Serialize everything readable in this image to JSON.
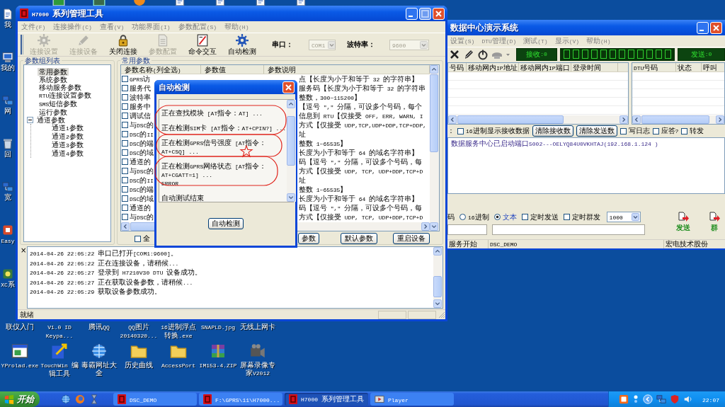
{
  "desktop": {
    "left_icons": [
      {
        "label": "我"
      },
      {
        "label": "我的"
      },
      {
        "label": "网"
      },
      {
        "label": "回"
      },
      {
        "label": "宽"
      },
      {
        "label": "Easy"
      },
      {
        "label": "XC系"
      }
    ],
    "row_1_icons": [
      {
        "label": "联仪入门"
      },
      {
        "label": "V1.0 ID Keypa..."
      },
      {
        "label": "腾讯QQ"
      },
      {
        "label": "QQ图片 20140320..."
      },
      {
        "label": "16进制浮点转换.exe"
      },
      {
        "label": "SNAPLD.jpg"
      },
      {
        "label": "无线上网卡"
      }
    ],
    "row_2_icons": [
      {
        "label": "YProlad.exe"
      },
      {
        "label": "TouchWin 编辑工具"
      },
      {
        "label": "毒霸网址大全"
      },
      {
        "label": "历史曲线"
      },
      {
        "label": "AccessPort"
      },
      {
        "label": "IM153-4.ZIP"
      },
      {
        "label": "屏幕录像专家V2012"
      }
    ]
  },
  "main_window": {
    "title": "H7000 系列管理工具",
    "menu": [
      "文件(F)",
      "连接操作(C)",
      "查看(V)",
      "功能界面(I)",
      "参数配置(S)",
      "帮助(H)"
    ],
    "toolbar": [
      {
        "label": "连接设置",
        "disabled": true
      },
      {
        "label": "连接设备",
        "disabled": true
      },
      {
        "label": "关闭连接",
        "disabled": false
      },
      {
        "label": "参数配置",
        "disabled": true
      },
      {
        "label": "命令交互",
        "disabled": false
      },
      {
        "label": "自动检测",
        "disabled": false
      }
    ],
    "port": {
      "label": "串口：",
      "value": "COM1",
      "disabled": true
    },
    "baud": {
      "label": "波特率：",
      "value": "9600",
      "disabled": true
    },
    "tree": {
      "title": "参数组列表",
      "items": [
        {
          "label": "常用参数",
          "selected": true
        },
        {
          "label": "系统参数",
          "selected": false
        },
        {
          "label": "移动服务参数",
          "selected": false
        },
        {
          "label": "RTU连接设置参数",
          "selected": false
        },
        {
          "label": "SMS短信参数",
          "selected": false
        },
        {
          "label": "运行参数",
          "selected": false
        },
        {
          "label": "通道参数",
          "selected": false,
          "expanded": true,
          "children": [
            {
              "label": "通道1参数",
              "selected": false
            },
            {
              "label": "通道2参数",
              "selected": false
            },
            {
              "label": "通道3参数",
              "selected": false
            },
            {
              "label": "通道4参数",
              "selected": false
            }
          ]
        }
      ]
    },
    "params": {
      "title": "常用参数",
      "columns": [
        "参数名称(列全选)",
        "参数值",
        "参数说明"
      ],
      "rows": [
        {
          "checked": false,
          "name": "GPRS访",
          "description": "点【长度为小于和等于 32 的字符串】"
        },
        {
          "checked": false,
          "name": "服务代",
          "description": "服务码【长度为小于和等于 32 的字符串"
        },
        {
          "checked": false,
          "name": "波特率",
          "description": "整数，300~115200】"
        },
        {
          "checked": false,
          "name": "服务中",
          "description": "【逗号 \",\" 分隔，可设多个号码，每个"
        },
        {
          "checked": false,
          "name": "调试信",
          "description": "信息到 RTU【仅接受 OFF, ERR, WARN, I"
        },
        {
          "checked": false,
          "name": "与DSC的",
          "description": "方式【仅接受 UDP,TCP,UDP+DDP,TCP+DDP,"
        },
        {
          "checked": false,
          "name": "DSC的II",
          "description": "址"
        },
        {
          "checked": false,
          "name": "DSC的端",
          "description": "整数 1~65535】"
        },
        {
          "checked": false,
          "name": "DSC的域",
          "description": "长度为小于和等于 64 的域名字符串】"
        },
        {
          "checked": false,
          "name": "通道的",
          "description": "码【逗号 \",\" 分隔，可设多个号码，每"
        },
        {
          "checked": false,
          "name": "与DSC的",
          "description": "方式【仅接受 UDP, TCP, UDP+DDP,TCP+D"
        },
        {
          "checked": false,
          "name": "DSC的II",
          "description": "址"
        },
        {
          "checked": false,
          "name": "DSC的端",
          "description": "整数 1~65535】"
        },
        {
          "checked": false,
          "name": "DSC的域",
          "description": "长度为小于和等于 64 的域名字符串】"
        },
        {
          "checked": false,
          "name": "通道的",
          "description": "码【逗号 \",\" 分隔，可设多个号码，每"
        },
        {
          "checked": false,
          "name": "与DSC的",
          "description": "方式【仅接受 UDP, TCP, UDP+DDP,TCP+D"
        }
      ],
      "select_all": {
        "label": "全",
        "checked": false
      },
      "buttons": [
        "参数",
        "默认参数",
        "重启设备"
      ]
    },
    "log_close": "×",
    "log": [
      "2014-04-26 22:05:22 串口已打开[COM1:9600]。",
      "2014-04-26 22:05:22 正在连接设备，请稍候...",
      "2014-04-26 22:05:27 登录到 H7210V30 DTU 设备成功。",
      "2014-04-26 22:05:27 正在获取设备参数，请稍候...",
      "2014-04-26 22:05:29 获取设备参数成功。"
    ],
    "status": "就绪"
  },
  "dialog": {
    "title": "自动检测",
    "lines": [
      {
        "kind": "step",
        "text": "正在查找模块 [AT指令：AT] ..."
      },
      {
        "kind": "step",
        "text": "正在检测SIM卡 [AT指令：AT+CPIN?] ..."
      },
      {
        "kind": "step",
        "text": "正在检测GPRS信号强度 [AT指令："
      },
      {
        "kind": "more",
        "text": "AT+CSQ] ..."
      },
      {
        "kind": "step",
        "text": "正在检测GPRS网络状态 [AT指令："
      },
      {
        "kind": "more",
        "text": "AT+CGATT=1] ..."
      },
      {
        "kind": "more",
        "text": "ERROR"
      },
      {
        "kind": "step",
        "text": "自动测试结束"
      }
    ],
    "button": "自动检测"
  },
  "back_window": {
    "title": "数据中心演示系统",
    "menu": [
      "设置(S)",
      "DTU管理(D)",
      "测试(T)",
      "显示(V)",
      "帮助(H)"
    ],
    "receive": "接收:0",
    "send": "发送:0",
    "left_columns": [
      "号码",
      "移动网内IP地址",
      "移动网内IP端口",
      "登录时间"
    ],
    "right_columns": [
      "DTU号码",
      "状态",
      "呼叫"
    ],
    "options_label": "：",
    "options": [
      {
        "kind": "checkbox",
        "label": "16进制显示接收数据",
        "checked": false
      },
      {
        "kind": "button",
        "label": "清除接收数"
      },
      {
        "kind": "button",
        "label": "清除发送数"
      },
      {
        "kind": "checkbox",
        "label": "写日志",
        "checked": false
      },
      {
        "kind": "checkbox",
        "label": "应答?",
        "checked": false
      },
      {
        "kind": "checkbox",
        "label": "转发",
        "checked": false
      }
    ],
    "messages": [
      "数据服务中心已启动端口5002---OELYQ84U0VKHTAJ(192.168.1.124  )"
    ],
    "send_label": "码",
    "send_options": [
      {
        "kind": "radio",
        "label": "16进制",
        "selected": false
      },
      {
        "kind": "radio",
        "label": "文本",
        "selected": true
      },
      {
        "kind": "checkbox",
        "label": "定时发送",
        "checked": false
      },
      {
        "kind": "checkbox",
        "label": "定时群发",
        "checked": false
      }
    ],
    "interval": "1000",
    "actions": [
      "发送",
      "群"
    ],
    "status": [
      "服务开始",
      "DSC_DEMO",
      "宏电技术股份"
    ]
  },
  "taskbar": {
    "start": "开始",
    "tasks": [
      {
        "label": "DSC_DEMO",
        "selected": false
      },
      {
        "label": "F:\\GPRS\\11\\H7000...",
        "selected": false
      },
      {
        "label": "H7000 系列管理工具",
        "selected": true
      },
      {
        "label": "Player",
        "selected": false
      }
    ],
    "clock": "22:07"
  }
}
